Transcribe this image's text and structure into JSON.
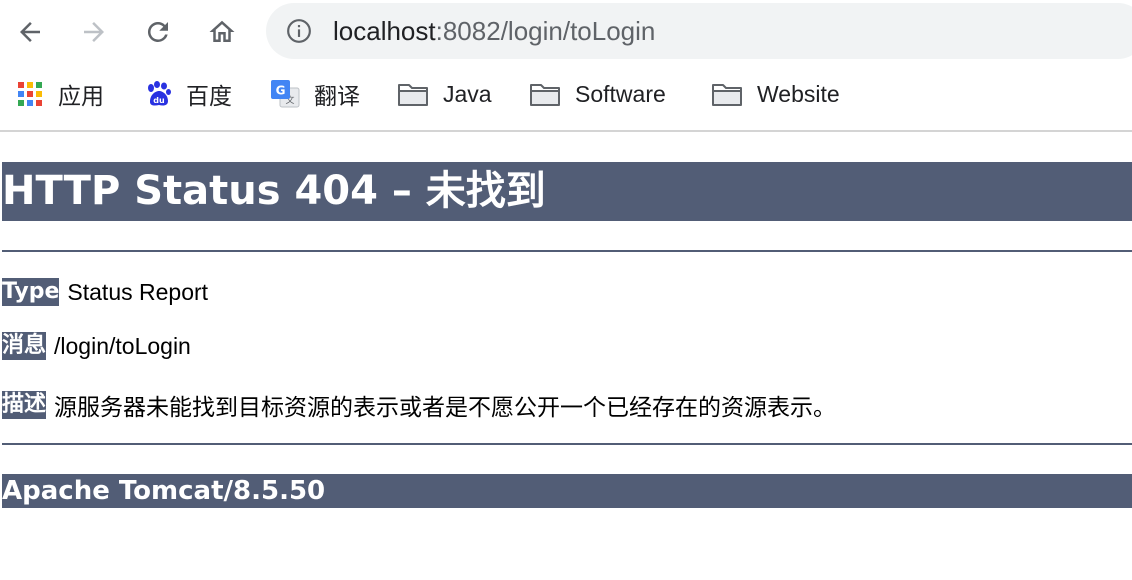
{
  "browser": {
    "address_host": "localhost",
    "address_rest": ":8082/login/toLogin",
    "icons": [
      "back-arrow-icon",
      "forward-arrow-icon",
      "reload-icon",
      "home-icon",
      "info-icon"
    ]
  },
  "bookmarks": [
    {
      "label": "应用",
      "icon": "apps-grid-icon"
    },
    {
      "label": "百度",
      "icon": "baidu-paw-icon"
    },
    {
      "label": "翻译",
      "icon": "google-translate-icon"
    },
    {
      "label": "Java",
      "icon": "folder-icon"
    },
    {
      "label": "Software",
      "icon": "folder-icon"
    },
    {
      "label": "Website",
      "icon": "folder-icon"
    }
  ],
  "error_page": {
    "title": "HTTP Status 404 – 未找到",
    "type_label": "Type",
    "type_value": "Status Report",
    "message_label": "消息",
    "message_value": "/login/toLogin",
    "description_label": "描述",
    "description_value": "源服务器未能找到目标资源的表示或者是不愿公开一个已经存在的资源表示。",
    "server_version": "Apache Tomcat/8.5.50"
  },
  "colors": {
    "tomcat_header_bg": "#525d76",
    "address_bar_bg": "#f1f3f4"
  }
}
